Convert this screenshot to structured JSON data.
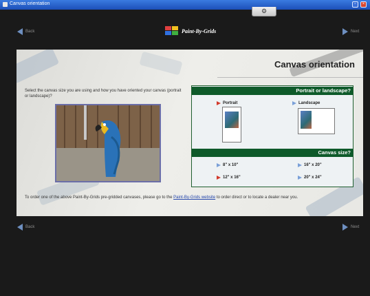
{
  "window": {
    "title": "Canvas orientation"
  },
  "toolbar": {
    "tab_glyph": "⚙"
  },
  "nav": {
    "back": "Back",
    "next": "Next"
  },
  "logo": {
    "text": "Paint-By-Grids"
  },
  "page": {
    "title": "Canvas orientation",
    "intro": "Select the canvas size you are using and how you have oriented your canvas (portrait or landscape)?"
  },
  "orientation": {
    "heading": "Portrait or landscape?",
    "options": [
      {
        "label": "Portrait",
        "selected": true
      },
      {
        "label": "Landscape",
        "selected": false
      }
    ]
  },
  "canvas_size": {
    "heading": "Canvas size?",
    "options": [
      {
        "label": "8\" x 10\"",
        "selected": false
      },
      {
        "label": "16\" x 20\"",
        "selected": false
      },
      {
        "label": "12\" x 16\"",
        "selected": true
      },
      {
        "label": "20\" x 24\"",
        "selected": false
      }
    ]
  },
  "footer": {
    "before": "To order one of the above Paint-By-Grids pre-gridded canvases, please go to the ",
    "link": "Paint-By-Grids website",
    "after": " to order direct or to locate a dealer near you."
  },
  "colors": {
    "accent_green": "#0e5a2a",
    "selected_arrow": "#d23a2c",
    "nav_arrow": "#6e8fc0"
  }
}
